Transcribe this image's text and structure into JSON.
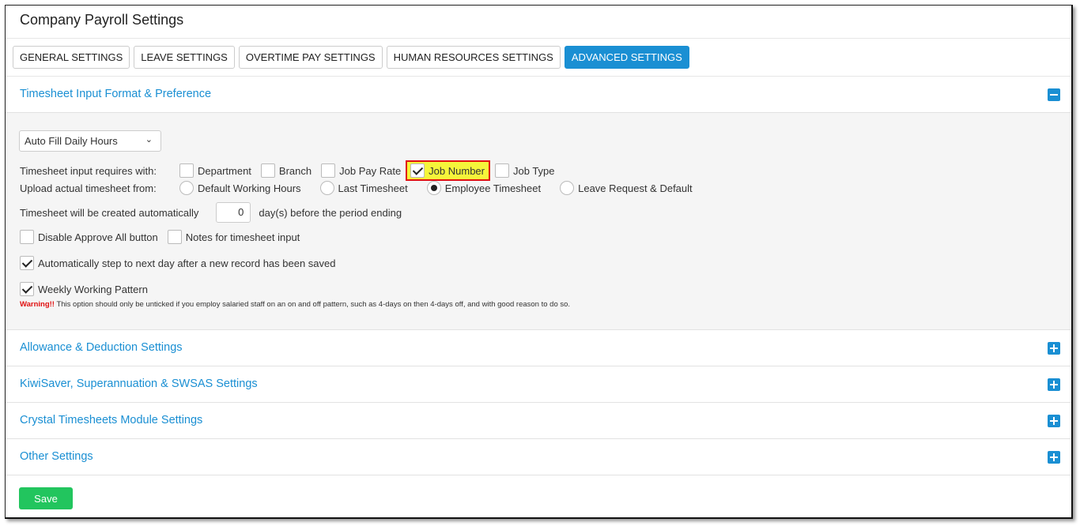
{
  "title": "Company Payroll Settings",
  "tabs": [
    "GENERAL SETTINGS",
    "LEAVE SETTINGS",
    "OVERTIME PAY SETTINGS",
    "HUMAN RESOURCES SETTINGS",
    "ADVANCED SETTINGS"
  ],
  "timesheet": {
    "header": "Timesheet Input Format & Preference",
    "dropdown": "Auto Fill Daily Hours",
    "requires_label": "Timesheet input requires with:",
    "requires": [
      {
        "label": "Department",
        "checked": false
      },
      {
        "label": "Branch",
        "checked": false
      },
      {
        "label": "Job Pay Rate",
        "checked": false
      },
      {
        "label": "Job Number",
        "checked": true
      },
      {
        "label": "Job Type",
        "checked": false
      }
    ],
    "upload_label": "Upload actual timesheet from:",
    "upload": [
      {
        "label": "Default Working Hours",
        "selected": false
      },
      {
        "label": "Last Timesheet",
        "selected": false
      },
      {
        "label": "Employee Timesheet",
        "selected": true
      },
      {
        "label": "Leave Request & Default",
        "selected": false
      }
    ],
    "auto_label": "Timesheet will be created automatically",
    "auto_days": "0",
    "auto_suffix": "day(s) before the period ending",
    "disable_approve": "Disable Approve All button",
    "notes": "Notes for timesheet input",
    "auto_step": "Automatically step to next day after a new record has been saved",
    "weekly": "Weekly Working Pattern",
    "warning_label": "Warning!!",
    "warning_text": " This option should only be unticked if you employ salaried staff on an on and off pattern, such as 4-days on then 4-days off, and with good reason to do so."
  },
  "sections": [
    "Allowance & Deduction Settings",
    "KiwiSaver, Superannuation & SWSAS Settings",
    "Crystal Timesheets Module Settings",
    "Other Settings"
  ],
  "save": "Save"
}
